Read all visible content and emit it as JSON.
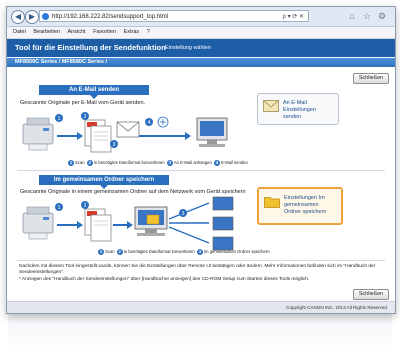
{
  "browser": {
    "url": "http://192.168.222.82/sendsupport_top.html",
    "url_controls": "ρ ▾ ⟳ ✕",
    "menu": [
      "Datei",
      "Bearbeiten",
      "Ansicht",
      "Favoriten",
      "Extras",
      "?"
    ]
  },
  "page": {
    "title": "Tool für die Einstellung der Sendefunktion",
    "subtitle": "Einstellung wählen",
    "series": "MF8500C Series / MF8580C Series /",
    "close_label": "Schließen",
    "close_label_bottom": "Schließen"
  },
  "email_section": {
    "title": "An E-Mail senden",
    "description": "Gescannte Originale per E-Mail vom Gerät senden.",
    "button_label": "An E-Mail Einstellungen senden",
    "legend": [
      {
        "n": "1",
        "text": "Scan"
      },
      {
        "n": "2",
        "text": "In benötigtes Dateiformat konvertieren"
      },
      {
        "n": "3",
        "text": "An E-Mail anhängen"
      },
      {
        "n": "4",
        "text": "E-Mail senden"
      }
    ]
  },
  "folder_section": {
    "title": "Im gemeinsamen Ordner speichern",
    "description": "Gescannte Originale in einem gemeinsamen Ordner auf dem Netzwerk vom Gerät speichern",
    "button_label": "Einstellungen Im gemeinsamen Ordner speichern",
    "legend": [
      {
        "n": "1",
        "text": "Scan"
      },
      {
        "n": "2",
        "text": "In benötigtes Dateiformat konvertieren"
      },
      {
        "n": "3",
        "text": "Im gemeinsamen Ordner speichern"
      }
    ]
  },
  "notes": [
    "Nachdem mit diesem Tool eingestellt wurde, können Sie die Einstellungen über Remote UI bestätigen oder ändern. Mehr Informationen befinden sich im \"Handbuch der Sendeeinstellungen\".",
    "* Anzeigen des \"Handbuch der Sendeeinstellungen\" über [Handbücher anzeigen] des CD-ROM Setup zum Starten dieses Tools möglich."
  ],
  "footer": {
    "copyright": "Copyright CANON INC. 2013 All Rights Reserved"
  },
  "colors": {
    "header": "#1d5ea7",
    "accent": "#2a6fbf",
    "highlight": "#f0a23c"
  }
}
